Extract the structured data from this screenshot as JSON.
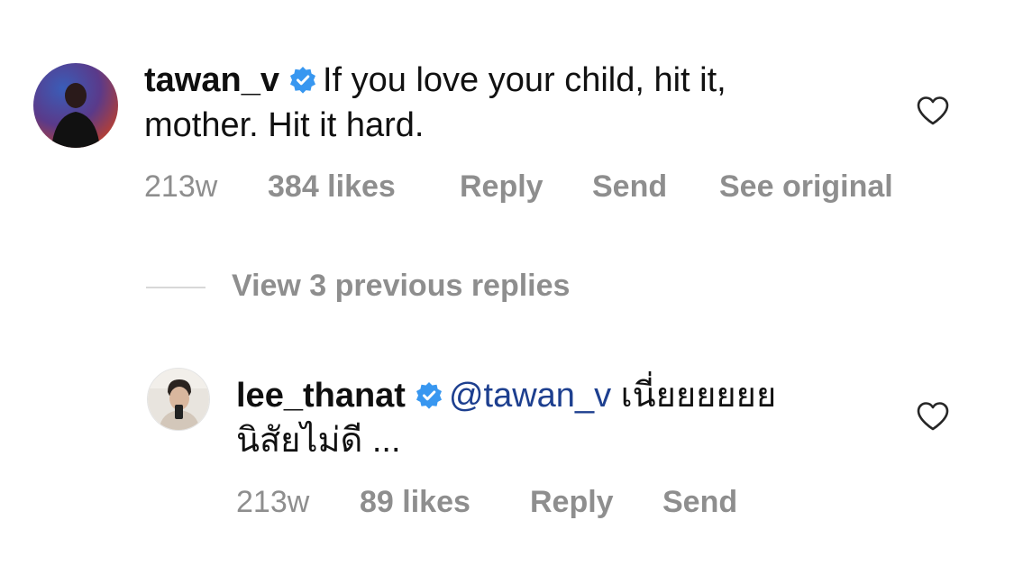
{
  "comments": [
    {
      "username": "tawan_v",
      "text_line1": "If you love your child, hit it,",
      "text_line2": "mother. Hit it hard.",
      "time": "213w",
      "likes": "384 likes",
      "reply_label": "Reply",
      "send_label": "Send",
      "see_original_label": "See original",
      "avatar_icon": "profile-photo-icon",
      "verified_icon": "verified-badge-icon",
      "like_icon": "heart-outline-icon"
    }
  ],
  "view_replies": {
    "label": "View 3 previous replies"
  },
  "reply": {
    "username": "lee_thanat",
    "mention": "@tawan_v",
    "text_line1": "เนี่ยยยยยย",
    "text_line2": "นิสัยไม่ดี ...",
    "time": "213w",
    "likes": "89 likes",
    "reply_label": "Reply",
    "send_label": "Send",
    "avatar_icon": "profile-photo-icon",
    "verified_icon": "verified-badge-icon",
    "like_icon": "heart-outline-icon"
  },
  "colors": {
    "verified_blue": "#3897f0",
    "meta_gray": "#8e8e8e",
    "mention_blue": "#1d3f8f"
  }
}
